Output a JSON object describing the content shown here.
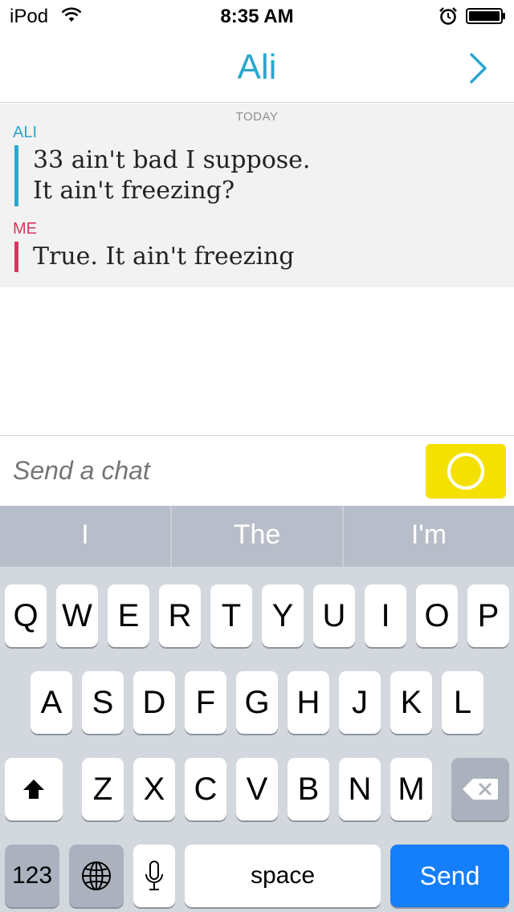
{
  "status_bar": {
    "carrier": "iPod",
    "time": "8:35 AM"
  },
  "nav": {
    "title": "Ali"
  },
  "conversation": {
    "date_label": "TODAY",
    "messages": [
      {
        "sender": "ALI",
        "lines": [
          "33 ain't bad I suppose.",
          "It ain't freezing?"
        ]
      },
      {
        "sender": "ME",
        "lines": [
          "True. It ain't freezing"
        ]
      }
    ]
  },
  "composer": {
    "placeholder": "Send a chat"
  },
  "predictions": [
    "I",
    "The",
    "I'm"
  ],
  "keyboard": {
    "row1": [
      "Q",
      "W",
      "E",
      "R",
      "T",
      "Y",
      "U",
      "I",
      "O",
      "P"
    ],
    "row2": [
      "A",
      "S",
      "D",
      "F",
      "G",
      "H",
      "J",
      "K",
      "L"
    ],
    "row3": [
      "Z",
      "X",
      "C",
      "V",
      "B",
      "N",
      "M"
    ],
    "numbers_label": "123",
    "space_label": "space",
    "send_label": "Send"
  },
  "colors": {
    "accent_blue": "#2aa7cf",
    "me_red": "#d8375d",
    "camera_yellow": "#f5e100",
    "send_blue": "#157efb"
  },
  "icons": {
    "wifi": "wifi-icon",
    "alarm": "alarm-icon",
    "battery": "battery-icon",
    "forward": "chevron-right-icon",
    "camera": "camera-circle-icon",
    "shift": "shift-icon",
    "delete": "backspace-icon",
    "globe": "globe-icon",
    "mic": "microphone-icon"
  }
}
